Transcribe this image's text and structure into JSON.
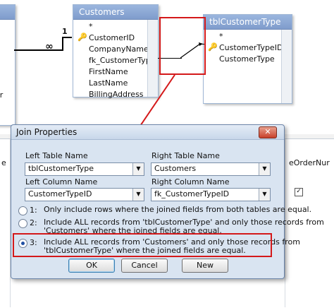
{
  "tables": {
    "left_partial": {
      "relationship_one": "1",
      "relationship_many": "∞",
      "partial_field": "er"
    },
    "customers": {
      "title": "Customers",
      "fields": [
        "*",
        "CustomerID",
        "CompanyName",
        "fk_CustomerTyp",
        "FirstName",
        "LastName",
        "BillingAddress"
      ],
      "key_field_index": 1
    },
    "tblCustomerType": {
      "title": "tblCustomerType",
      "fields": [
        "*",
        "CustomerTypeID",
        "CustomerType"
      ],
      "key_field_index": 1
    }
  },
  "grid": {
    "partial_left": "e",
    "partial_right": "eOrderNur"
  },
  "dialog": {
    "title": "Join Properties",
    "close_label": "✕",
    "left_table_label": "Left Table Name",
    "left_table_value": "tblCustomerType",
    "right_table_label": "Right Table Name",
    "right_table_value": "Customers",
    "left_column_label": "Left Column Name",
    "left_column_value": "CustomerTypeID",
    "right_column_label": "Right Column Name",
    "right_column_value": "fk_CustomerTypeID",
    "options": [
      {
        "num": "1:",
        "line1": "Only include rows where the joined fields from both tables are equal.",
        "line2": ""
      },
      {
        "num": "2:",
        "line1": "Include ALL records from 'tblCustomerType' and only those records from",
        "line2": "'Customers' where the joined fields are equal."
      },
      {
        "num": "3:",
        "line1": "Include ALL records from 'Customers' and only those records from",
        "line2": "'tblCustomerType' where the joined fields are equal."
      }
    ],
    "selected_option": 3,
    "ok_label": "OK",
    "cancel_label": "Cancel",
    "new_label": "New"
  },
  "colors": {
    "annotation": "#d4191a",
    "title_bar": "#8aa6d4"
  }
}
